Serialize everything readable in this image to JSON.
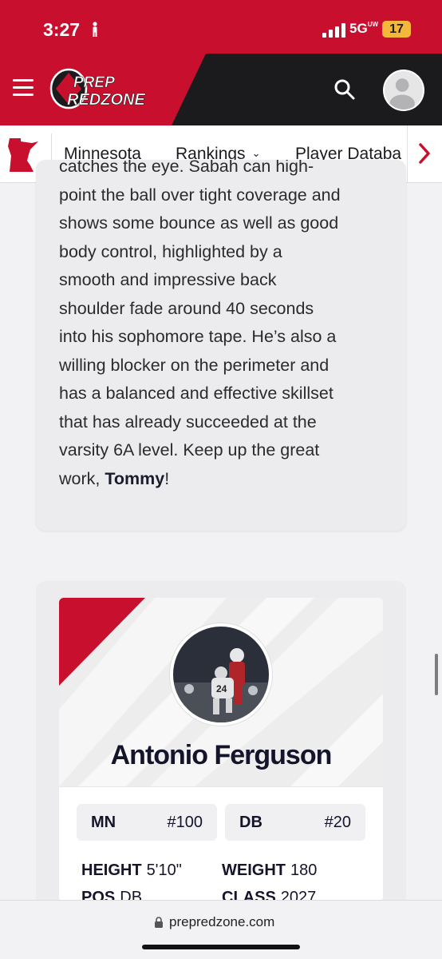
{
  "status": {
    "time": "3:27",
    "network": "5G",
    "network_sup": "UW",
    "battery": "17"
  },
  "header": {
    "logo_line1": "PREP",
    "logo_line2": "REDZONE",
    "menu_icon": "hamburger-icon",
    "search_icon": "search-icon",
    "avatar_icon": "user-avatar-icon"
  },
  "subnav": {
    "state_icon": "minnesota-map-icon",
    "items": [
      "Minnesota",
      "Rankings",
      "Player Databa"
    ],
    "scroll_icon": "chevron-right-icon"
  },
  "article": {
    "partial_top": "catches the eye. Sabah can high-",
    "lines": [
      "point the ball over tight coverage and",
      "shows some bounce as well as good",
      "body control, highlighted by a",
      "smooth and impressive back",
      "shoulder fade around 40 seconds",
      "into his sophomore tape. He’s also a",
      "willing blocker on the perimeter and",
      "has a balanced and effective skillset",
      "that has already succeeded at the",
      "varsity 6A level. Keep up the great"
    ],
    "last_prefix": "work, ",
    "last_bold": "Tommy",
    "last_suffix": "!"
  },
  "player": {
    "name": "Antonio Ferguson",
    "state": "MN",
    "state_rank": "#100",
    "position": "DB",
    "position_rank": "#20",
    "height_label": "HEIGHT",
    "height": "5'10\"",
    "weight_label": "WEIGHT",
    "weight": "180",
    "pos_label": "POS",
    "pos": "DB",
    "class_label": "CLASS",
    "class": "2027"
  },
  "browser": {
    "url": "prepredzone.com"
  },
  "colors": {
    "brand_red": "#c8102e",
    "dark": "#1b1b1d",
    "card_bg": "#ececee"
  }
}
